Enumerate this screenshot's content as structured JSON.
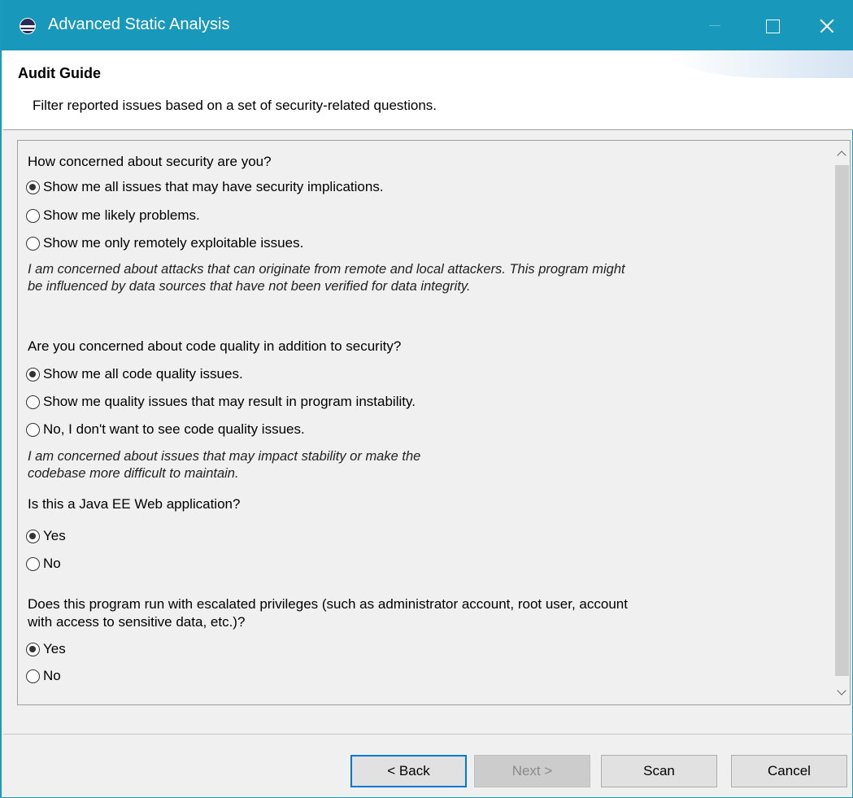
{
  "window": {
    "title": "Advanced Static Analysis"
  },
  "header": {
    "title": "Audit Guide",
    "description": "Filter reported issues based on a set of security-related questions."
  },
  "questions": [
    {
      "text": "How concerned about security are you?",
      "options": [
        {
          "label": "Show me all issues that may have security implications.",
          "selected": true
        },
        {
          "label": "Show me likely problems.",
          "selected": false
        },
        {
          "label": "Show me only remotely exploitable issues.",
          "selected": false
        }
      ],
      "description": "I am concerned about attacks that can originate from remote and local attackers. This program might be influenced by data sources that have not been verified for data integrity."
    },
    {
      "text": "Are you concerned about code quality in addition to security?",
      "options": [
        {
          "label": "Show me all code quality issues.",
          "selected": true
        },
        {
          "label": "Show me quality issues that may result in program instability.",
          "selected": false
        },
        {
          "label": "No, I don't want to see code quality issues.",
          "selected": false
        }
      ],
      "description": "I am concerned about issues that may impact stability or make the codebase more difficult to maintain."
    },
    {
      "text": "Is this a Java EE Web application?",
      "options": [
        {
          "label": "Yes",
          "selected": true
        },
        {
          "label": "No",
          "selected": false
        }
      ]
    },
    {
      "text": "Does this program run with escalated privileges (such as administrator account, root user, account with access to sensitive data, etc.)?",
      "options": [
        {
          "label": "Yes",
          "selected": true
        },
        {
          "label": "No",
          "selected": false
        }
      ]
    }
  ],
  "footer": {
    "back_label": "< Back",
    "next_label": "Next >",
    "scan_label": "Scan",
    "cancel_label": "Cancel"
  }
}
